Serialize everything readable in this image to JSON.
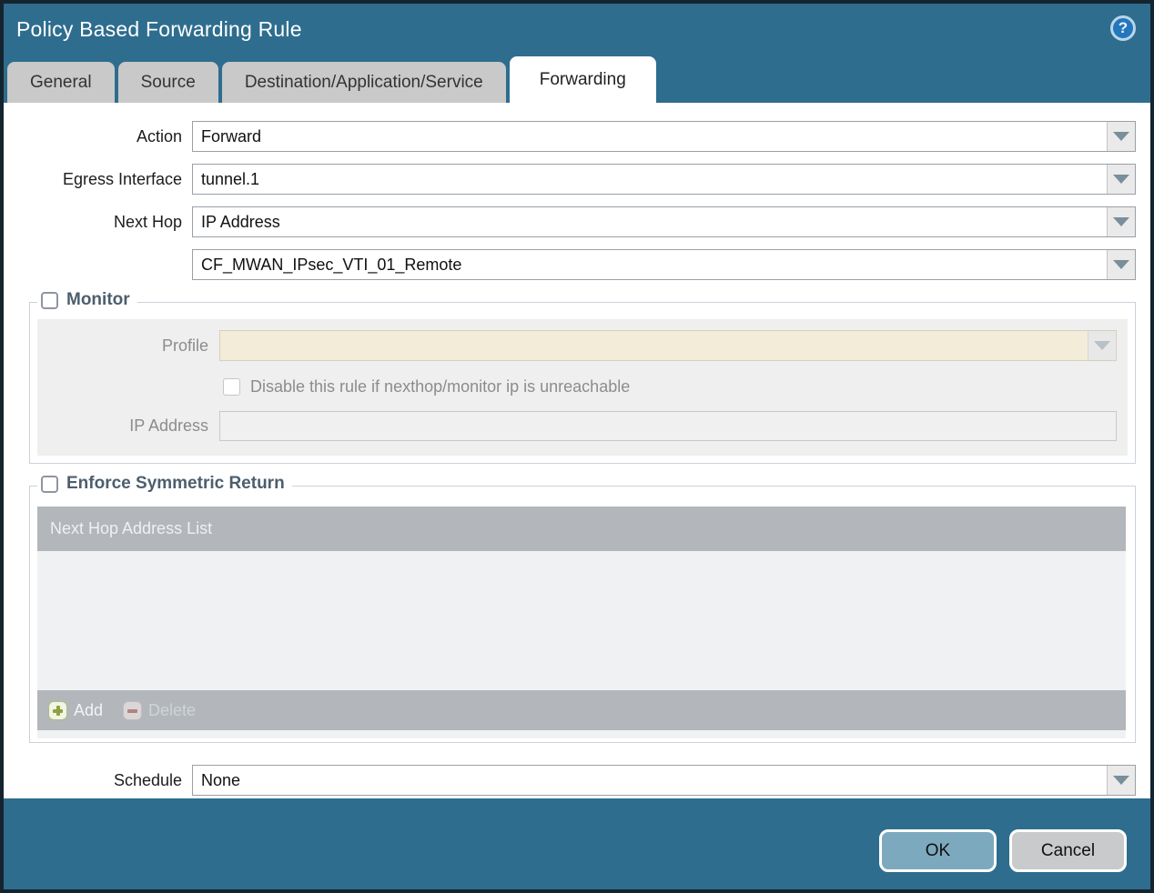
{
  "dialog": {
    "title": "Policy Based Forwarding Rule",
    "help_icon": "question-mark"
  },
  "tabs": [
    {
      "label": "General",
      "active": false
    },
    {
      "label": "Source",
      "active": false
    },
    {
      "label": "Destination/Application/Service",
      "active": false
    },
    {
      "label": "Forwarding",
      "active": true
    }
  ],
  "form": {
    "action": {
      "label": "Action",
      "value": "Forward"
    },
    "egress_interface": {
      "label": "Egress Interface",
      "value": "tunnel.1"
    },
    "next_hop": {
      "label": "Next Hop",
      "value": "IP Address"
    },
    "next_hop_address": {
      "value": "CF_MWAN_IPsec_VTI_01_Remote"
    },
    "schedule": {
      "label": "Schedule",
      "value": "None"
    }
  },
  "monitor": {
    "legend": "Monitor",
    "checked": false,
    "profile": {
      "label": "Profile",
      "value": ""
    },
    "disable_rule": {
      "label": "Disable this rule if nexthop/monitor ip is unreachable",
      "checked": false
    },
    "ip_address": {
      "label": "IP Address",
      "value": ""
    }
  },
  "symmetric_return": {
    "legend": "Enforce Symmetric Return",
    "checked": false,
    "table": {
      "header": "Next Hop Address List",
      "rows": []
    },
    "add_label": "Add",
    "delete_label": "Delete"
  },
  "footer": {
    "ok_label": "OK",
    "cancel_label": "Cancel"
  },
  "colors": {
    "titlebar_teal": "#2e6d8e",
    "active_tab": "#ffffff",
    "inactive_tab": "#c9c9c9",
    "table_gray": "#b3b7bb",
    "disabled_field_beige": "#f2ecd9",
    "ok_button_blue": "#7da9be",
    "cancel_button_gray": "#c9cacc",
    "add_icon_green": "#8ba33c",
    "delete_icon_red": "#b2716d"
  }
}
